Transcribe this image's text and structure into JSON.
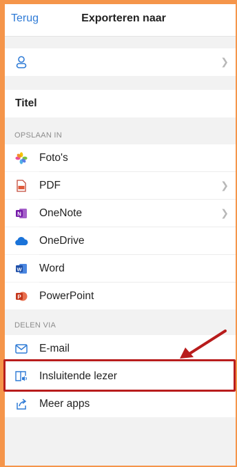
{
  "nav": {
    "back_label": "Terug",
    "title": "Exporteren naar"
  },
  "account_row": {
    "icon": "person-icon"
  },
  "title_row": {
    "label": "Titel"
  },
  "save_section": {
    "header": "OPSLAAN IN",
    "items": [
      {
        "label": "Foto's",
        "icon": "photos-icon",
        "chevron": false
      },
      {
        "label": "PDF",
        "icon": "pdf-icon",
        "chevron": true
      },
      {
        "label": "OneNote",
        "icon": "onenote-icon",
        "chevron": true
      },
      {
        "label": "OneDrive",
        "icon": "onedrive-icon",
        "chevron": false
      },
      {
        "label": "Word",
        "icon": "word-icon",
        "chevron": false
      },
      {
        "label": "PowerPoint",
        "icon": "powerpoint-icon",
        "chevron": false
      }
    ]
  },
  "share_section": {
    "header": "DELEN VIA",
    "items": [
      {
        "label": "E-mail",
        "icon": "mail-icon"
      },
      {
        "label": "Insluitende lezer",
        "icon": "immersive-reader-icon",
        "highlighted": true
      },
      {
        "label": "Meer apps",
        "icon": "share-icon"
      }
    ]
  },
  "colors": {
    "accent": "#2f7bd6",
    "highlight": "#b81c1c",
    "frame": "#f5954a"
  }
}
